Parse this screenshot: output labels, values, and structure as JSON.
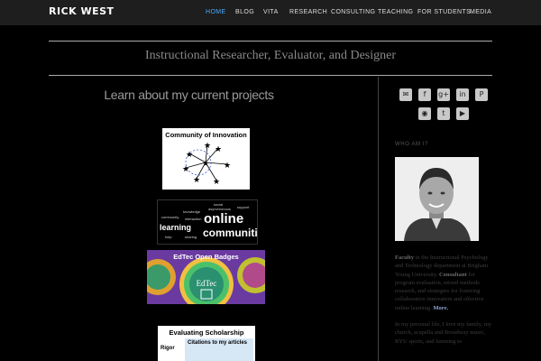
{
  "site": {
    "brand": "RICK WEST",
    "tagline": "Instructional Researcher, Evaluator, and Designer"
  },
  "nav": [
    {
      "label": "HOME",
      "active": true
    },
    {
      "label": "BLOG"
    },
    {
      "label": "VITA"
    },
    {
      "label": "RESEARCH"
    },
    {
      "label": "CONSULTING"
    },
    {
      "label": "TEACHING"
    },
    {
      "label": "FOR STUDENTS"
    },
    {
      "label": "MEDIA"
    }
  ],
  "main": {
    "heading": "Learn about my current projects",
    "projects": {
      "innovation": {
        "title": "Community of Innovation"
      },
      "online": {
        "words": [
          "learning",
          "online",
          "communities",
          "social",
          "asynchronous",
          "knowledge",
          "interaction",
          "community",
          "support",
          "sharing",
          "help"
        ]
      },
      "badges": {
        "title": "EdTec Open Badges",
        "badge_label": "EdTec"
      },
      "scholarship": {
        "title": "Evaluating Scholarship",
        "subtitle": "Citations to my articles",
        "side_letters": "Rigor"
      }
    }
  },
  "sidebar": {
    "social_icons": [
      "email-icon",
      "facebook-icon",
      "google-plus-icon",
      "linkedin-icon",
      "pinterest-icon",
      "rss-icon",
      "twitter-icon",
      "youtube-icon"
    ],
    "social_glyphs": [
      "✉",
      "f",
      "g+",
      "in",
      "P",
      "◉",
      "t",
      "▶"
    ],
    "whoami": "WHO AM I?",
    "bio": {
      "faculty": "Faculty",
      "faculty_text": " in the Instructional Psychology and Technology department at Brigham Young University.",
      "consultant": "Consultant",
      "consultant_text": " for program evaluation, mixed methods research, and strategies for fostering collaborative innovation and effective online learning.",
      "more": "More.",
      "personal": "In my personal life, I love my family, my church, acapella and Broadway music, BYU sports, and listening to"
    }
  },
  "colors": {
    "accent": "#4aa8ff",
    "topbar": "#1e1e1e",
    "background": "#000000"
  }
}
